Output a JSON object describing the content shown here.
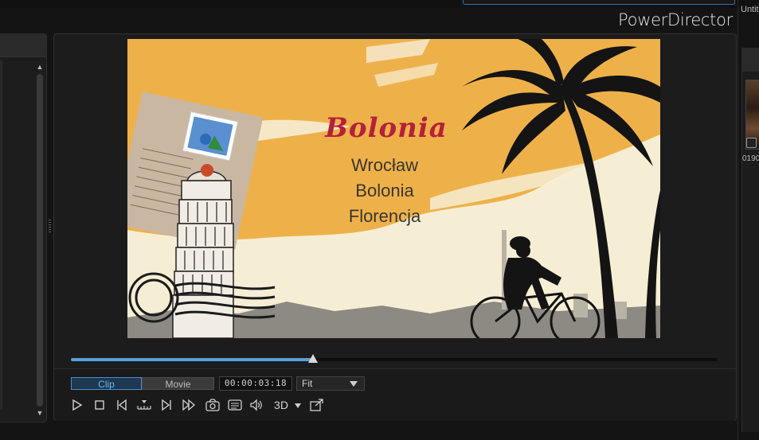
{
  "window": {
    "app_title": "PowerDirector",
    "project_name": "Untitled"
  },
  "preview": {
    "title_text": "Bolonia",
    "overlay_lines": [
      "Wrocław",
      "Bolonia",
      "Florencja"
    ],
    "playhead_fraction": 0.374
  },
  "controls": {
    "clip_label": "Clip",
    "movie_label": "Movie",
    "timecode": "00:00:03:18",
    "zoom_value": "Fit",
    "three_d_label": "3D"
  },
  "media_library": {
    "thumbnail_label": "0190"
  },
  "icons": [
    "play-icon",
    "stop-icon",
    "previous-frame-icon",
    "split-icon",
    "next-frame-icon",
    "fast-forward-icon",
    "snapshot-icon",
    "subtitle-icon",
    "volume-icon",
    "undock-icon"
  ],
  "colors": {
    "accent": "#5aa0d6",
    "clip_active_text": "#6fb4ee",
    "title_red": "#b5203a"
  }
}
